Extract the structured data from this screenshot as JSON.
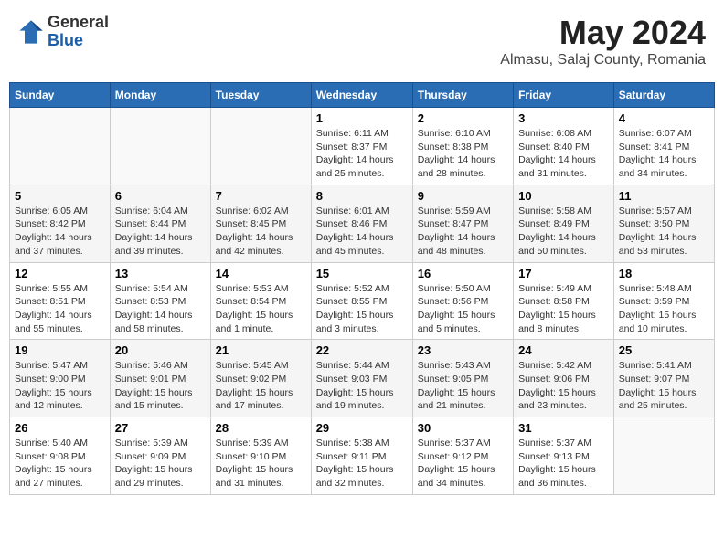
{
  "header": {
    "logo_general": "General",
    "logo_blue": "Blue",
    "month_title": "May 2024",
    "location": "Almasu, Salaj County, Romania"
  },
  "days_of_week": [
    "Sunday",
    "Monday",
    "Tuesday",
    "Wednesday",
    "Thursday",
    "Friday",
    "Saturday"
  ],
  "weeks": [
    [
      {
        "day": "",
        "info": ""
      },
      {
        "day": "",
        "info": ""
      },
      {
        "day": "",
        "info": ""
      },
      {
        "day": "1",
        "info": "Sunrise: 6:11 AM\nSunset: 8:37 PM\nDaylight: 14 hours\nand 25 minutes."
      },
      {
        "day": "2",
        "info": "Sunrise: 6:10 AM\nSunset: 8:38 PM\nDaylight: 14 hours\nand 28 minutes."
      },
      {
        "day": "3",
        "info": "Sunrise: 6:08 AM\nSunset: 8:40 PM\nDaylight: 14 hours\nand 31 minutes."
      },
      {
        "day": "4",
        "info": "Sunrise: 6:07 AM\nSunset: 8:41 PM\nDaylight: 14 hours\nand 34 minutes."
      }
    ],
    [
      {
        "day": "5",
        "info": "Sunrise: 6:05 AM\nSunset: 8:42 PM\nDaylight: 14 hours\nand 37 minutes."
      },
      {
        "day": "6",
        "info": "Sunrise: 6:04 AM\nSunset: 8:44 PM\nDaylight: 14 hours\nand 39 minutes."
      },
      {
        "day": "7",
        "info": "Sunrise: 6:02 AM\nSunset: 8:45 PM\nDaylight: 14 hours\nand 42 minutes."
      },
      {
        "day": "8",
        "info": "Sunrise: 6:01 AM\nSunset: 8:46 PM\nDaylight: 14 hours\nand 45 minutes."
      },
      {
        "day": "9",
        "info": "Sunrise: 5:59 AM\nSunset: 8:47 PM\nDaylight: 14 hours\nand 48 minutes."
      },
      {
        "day": "10",
        "info": "Sunrise: 5:58 AM\nSunset: 8:49 PM\nDaylight: 14 hours\nand 50 minutes."
      },
      {
        "day": "11",
        "info": "Sunrise: 5:57 AM\nSunset: 8:50 PM\nDaylight: 14 hours\nand 53 minutes."
      }
    ],
    [
      {
        "day": "12",
        "info": "Sunrise: 5:55 AM\nSunset: 8:51 PM\nDaylight: 14 hours\nand 55 minutes."
      },
      {
        "day": "13",
        "info": "Sunrise: 5:54 AM\nSunset: 8:53 PM\nDaylight: 14 hours\nand 58 minutes."
      },
      {
        "day": "14",
        "info": "Sunrise: 5:53 AM\nSunset: 8:54 PM\nDaylight: 15 hours\nand 1 minute."
      },
      {
        "day": "15",
        "info": "Sunrise: 5:52 AM\nSunset: 8:55 PM\nDaylight: 15 hours\nand 3 minutes."
      },
      {
        "day": "16",
        "info": "Sunrise: 5:50 AM\nSunset: 8:56 PM\nDaylight: 15 hours\nand 5 minutes."
      },
      {
        "day": "17",
        "info": "Sunrise: 5:49 AM\nSunset: 8:58 PM\nDaylight: 15 hours\nand 8 minutes."
      },
      {
        "day": "18",
        "info": "Sunrise: 5:48 AM\nSunset: 8:59 PM\nDaylight: 15 hours\nand 10 minutes."
      }
    ],
    [
      {
        "day": "19",
        "info": "Sunrise: 5:47 AM\nSunset: 9:00 PM\nDaylight: 15 hours\nand 12 minutes."
      },
      {
        "day": "20",
        "info": "Sunrise: 5:46 AM\nSunset: 9:01 PM\nDaylight: 15 hours\nand 15 minutes."
      },
      {
        "day": "21",
        "info": "Sunrise: 5:45 AM\nSunset: 9:02 PM\nDaylight: 15 hours\nand 17 minutes."
      },
      {
        "day": "22",
        "info": "Sunrise: 5:44 AM\nSunset: 9:03 PM\nDaylight: 15 hours\nand 19 minutes."
      },
      {
        "day": "23",
        "info": "Sunrise: 5:43 AM\nSunset: 9:05 PM\nDaylight: 15 hours\nand 21 minutes."
      },
      {
        "day": "24",
        "info": "Sunrise: 5:42 AM\nSunset: 9:06 PM\nDaylight: 15 hours\nand 23 minutes."
      },
      {
        "day": "25",
        "info": "Sunrise: 5:41 AM\nSunset: 9:07 PM\nDaylight: 15 hours\nand 25 minutes."
      }
    ],
    [
      {
        "day": "26",
        "info": "Sunrise: 5:40 AM\nSunset: 9:08 PM\nDaylight: 15 hours\nand 27 minutes."
      },
      {
        "day": "27",
        "info": "Sunrise: 5:39 AM\nSunset: 9:09 PM\nDaylight: 15 hours\nand 29 minutes."
      },
      {
        "day": "28",
        "info": "Sunrise: 5:39 AM\nSunset: 9:10 PM\nDaylight: 15 hours\nand 31 minutes."
      },
      {
        "day": "29",
        "info": "Sunrise: 5:38 AM\nSunset: 9:11 PM\nDaylight: 15 hours\nand 32 minutes."
      },
      {
        "day": "30",
        "info": "Sunrise: 5:37 AM\nSunset: 9:12 PM\nDaylight: 15 hours\nand 34 minutes."
      },
      {
        "day": "31",
        "info": "Sunrise: 5:37 AM\nSunset: 9:13 PM\nDaylight: 15 hours\nand 36 minutes."
      },
      {
        "day": "",
        "info": ""
      }
    ]
  ]
}
